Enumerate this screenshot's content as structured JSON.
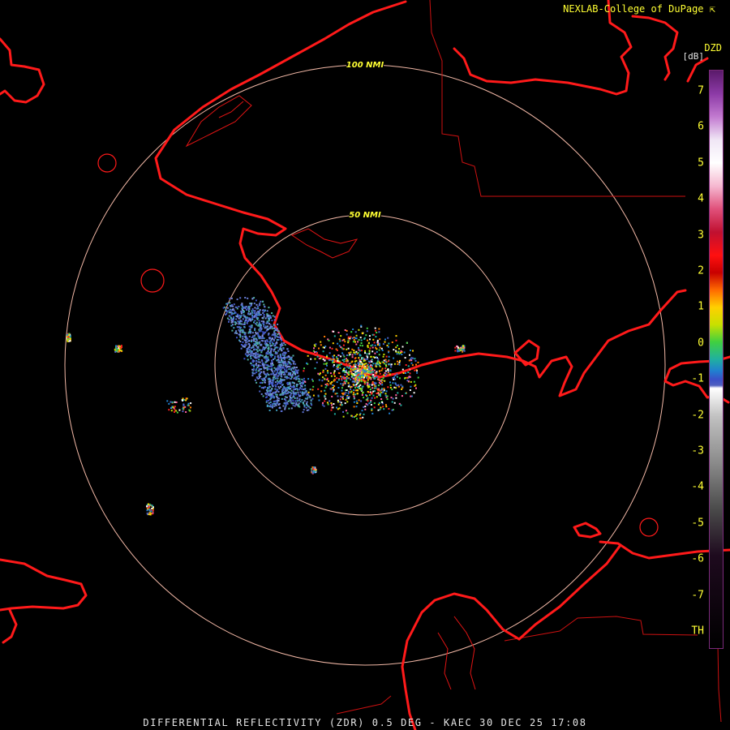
{
  "credit": "NEXLAB-College of DuPage",
  "caption": "DIFFERENTIAL REFLECTIVITY (ZDR) 0.5 DEG - KAEC 30 DEC 25 17:08",
  "colorbar": {
    "product": "DZD",
    "unit": "[dB]",
    "ticks": [
      "7",
      "6",
      "5",
      "4",
      "3",
      "2",
      "1",
      "0",
      "-1",
      "-2",
      "-3",
      "-4",
      "-5",
      "-6",
      "-7",
      "TH"
    ]
  },
  "rings": [
    {
      "label": "100 NMI"
    },
    {
      "label": "50 NMI"
    }
  ],
  "colors": {
    "coastline": "#ff1a1a",
    "boundary": "#cc1111",
    "ring": "#f2b8a6",
    "label": "#ffff33"
  }
}
